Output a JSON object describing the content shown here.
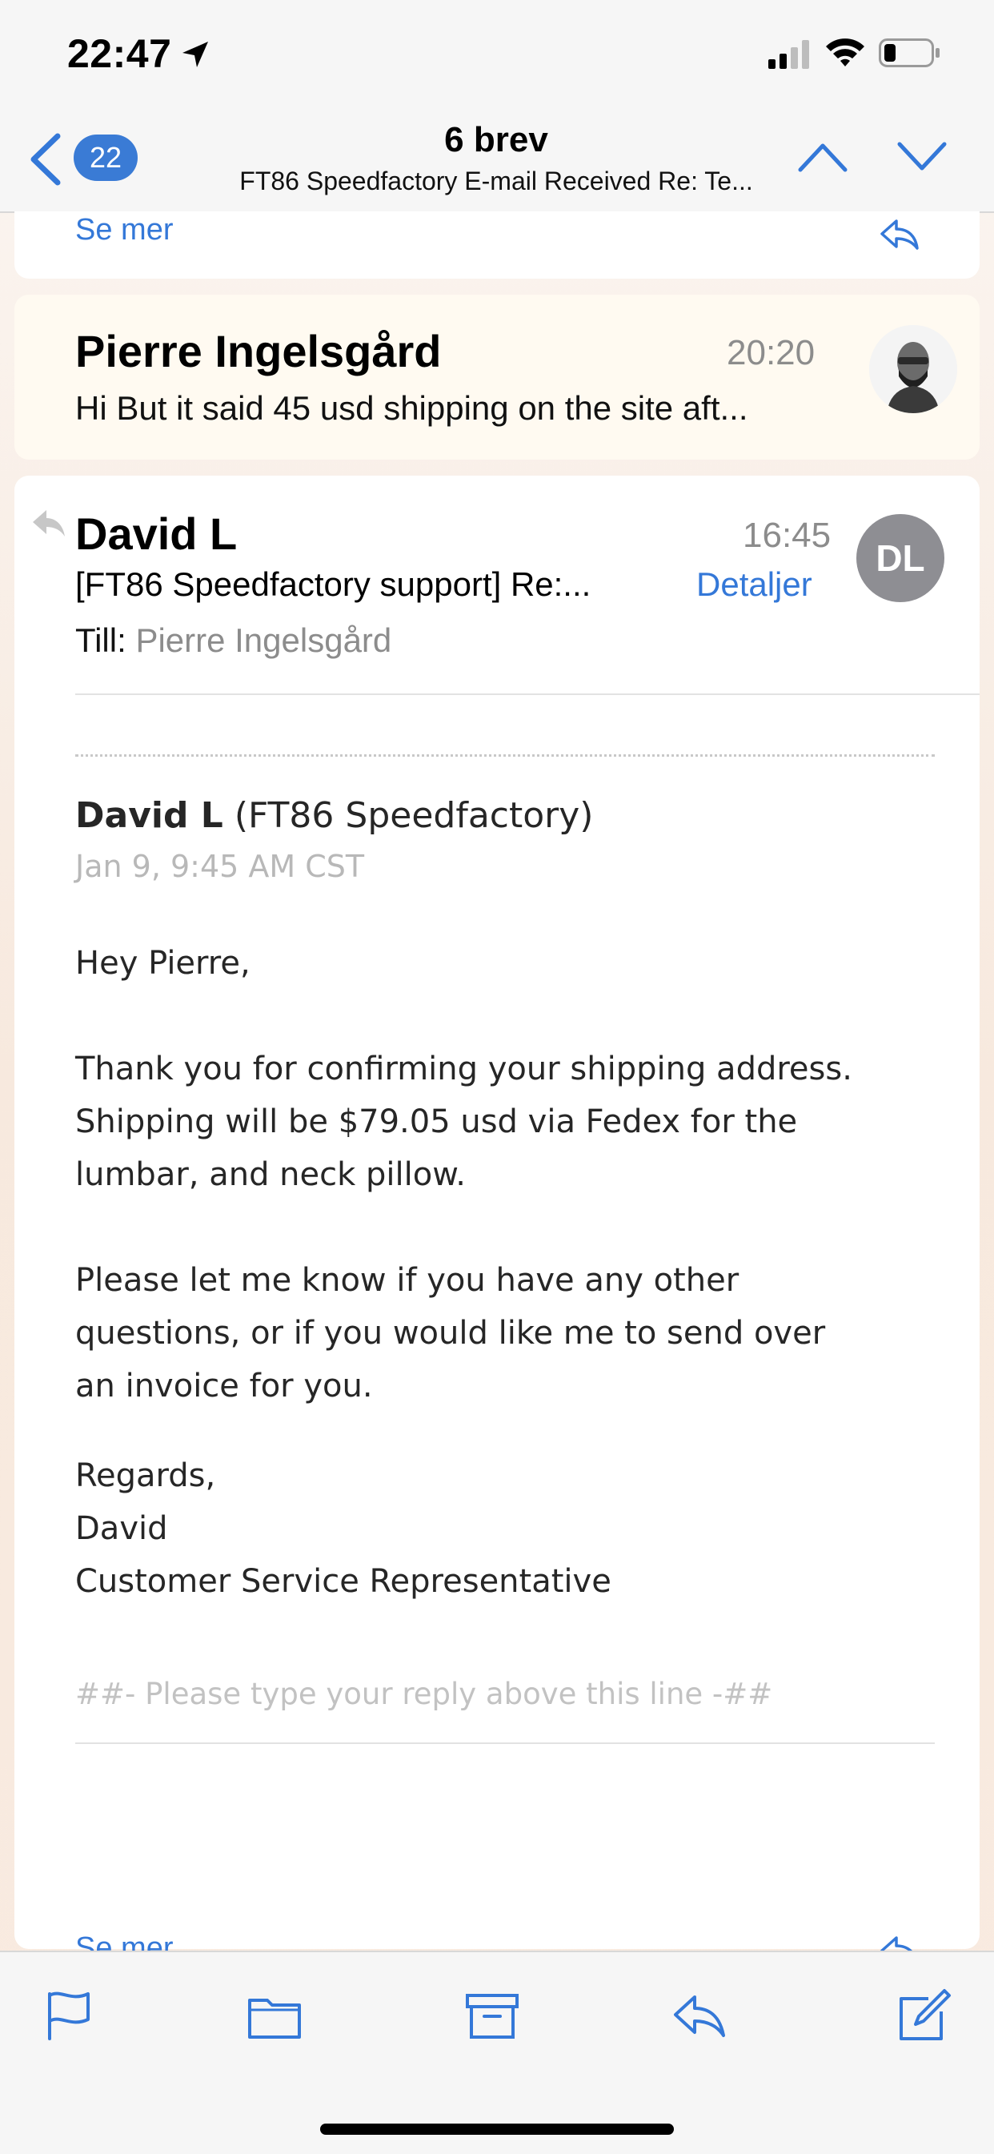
{
  "status_bar": {
    "time": "22:47"
  },
  "nav": {
    "badge_count": "22",
    "title": "6 brev",
    "subtitle": "FT86 Speedfactory E-mail Received Re: Te..."
  },
  "top_card": {
    "see_more": "Se mer"
  },
  "collapsed_message": {
    "sender": "Pierre Ingelsgård",
    "time": "20:20",
    "preview": "Hi But it said 45 usd shipping on the site aft..."
  },
  "open_message": {
    "sender": "David L",
    "time": "16:45",
    "avatar_initials": "DL",
    "subject": "[FT86 Speedfactory support] Re:...",
    "details_label": "Detaljer",
    "to_label": "Till:",
    "to_name": "Pierre Ingelsgård",
    "body": {
      "author_name": "David L",
      "author_org": "(FT86 Speedfactory)",
      "date": "Jan 9, 9:45 AM CST",
      "greeting": "Hey Pierre,",
      "para1_line1": "Thank you for confirming your shipping address.",
      "para1_line2": "Shipping will be $79.05 usd via Fedex for the",
      "para1_line3": "lumbar, and neck pillow.",
      "para2_line1": "Please let me know if you have any other",
      "para2_line2": "questions, or if you would like me to send over",
      "para2_line3": "an invoice for you.",
      "sign1": "Regards,",
      "sign2": "David",
      "sign3": "Customer Service Representative",
      "reply_marker": "##- Please type your reply above this line -##"
    },
    "see_more": "Se mer"
  },
  "accent_color": "#3478d8"
}
